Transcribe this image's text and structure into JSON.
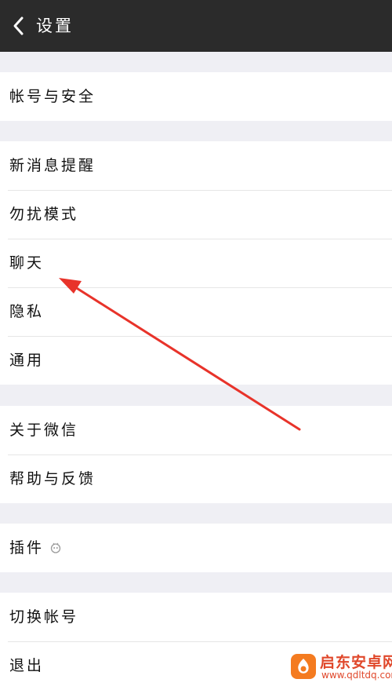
{
  "header": {
    "title": "设置",
    "back_icon": "chevron-left-icon"
  },
  "groups": [
    {
      "items": [
        {
          "label": "帐号与安全"
        }
      ]
    },
    {
      "items": [
        {
          "label": "新消息提醒"
        },
        {
          "label": "勿扰模式"
        },
        {
          "label": "聊天"
        },
        {
          "label": "隐私"
        },
        {
          "label": "通用"
        }
      ]
    },
    {
      "items": [
        {
          "label": "关于微信"
        },
        {
          "label": "帮助与反馈"
        }
      ]
    },
    {
      "items": [
        {
          "label": "插件",
          "icon": "plugin-icon"
        }
      ]
    },
    {
      "items": [
        {
          "label": "切换帐号"
        },
        {
          "label": "退出"
        }
      ]
    }
  ],
  "annotation": {
    "arrow_color": "#e8332a",
    "target": "聊天"
  },
  "watermark": {
    "title": "启东安卓网",
    "url": "www.qdltdq.com"
  },
  "colors": {
    "header_bg": "#2b2b2b",
    "page_bg": "#efeff4",
    "accent": "#e8332a"
  }
}
